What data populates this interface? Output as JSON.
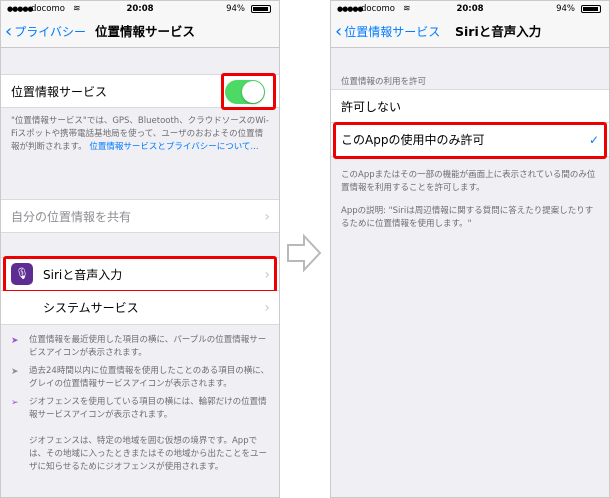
{
  "left": {
    "status": {
      "carrier": "docomo",
      "time": "20:08",
      "battery": "94%"
    },
    "nav": {
      "back_label": "プライバシー",
      "title": "位置情報サービス"
    },
    "location_toggle": {
      "label": "位置情報サービス",
      "on": true
    },
    "footer": {
      "text": "\"位置情報サービス\"では、GPS、Bluetooth、クラウドソースのWi-Fiスポットや携帯電話基地局を使って、ユーザのおおよその位置情報が判断されます。",
      "link": "位置情報サービスとプライバシーについて..."
    },
    "share_cell": {
      "label": "自分の位置情報を共有"
    },
    "siri_cell": {
      "label": "Siriと音声入力"
    },
    "system_cell": {
      "label": "システムサービス"
    },
    "legend": [
      {
        "icon": "purple-location-arrow-icon",
        "color": "#a052d1",
        "text": "位置情報を最近使用した項目の横に、パープルの位置情報サービスアイコンが表示されます。"
      },
      {
        "icon": "gray-location-arrow-icon",
        "color": "#8e8e93",
        "text": "過去24時間以内に位置情報を使用したことのある項目の横に、グレイの位置情報サービスアイコンが表示されます。"
      },
      {
        "icon": "outline-location-arrow-icon",
        "color": "#a052d1",
        "text": "ジオフェンスを使用している項目の横には、輪郭だけの位置情報サービスアイコンが表示されます。"
      }
    ],
    "geofence_note": "ジオフェンスは、特定の地域を囲む仮想の境界です。Appでは、その地域に入ったときまたはその地域から出たことをユーザに知らせるためにジオフェンスが使用されます。"
  },
  "right": {
    "status": {
      "carrier": "docomo",
      "time": "20:08",
      "battery": "94%"
    },
    "nav": {
      "back_label": "位置情報サービス",
      "title": "Siriと音声入力"
    },
    "section_header": "位置情報の利用を許可",
    "options": [
      {
        "label": "許可しない",
        "selected": false
      },
      {
        "label": "このAppの使用中のみ許可",
        "selected": true
      }
    ],
    "footer1": "このAppまたはその一部の機能が画面上に表示されている間のみ位置情報を利用することを許可します。",
    "footer2": "Appの説明: \"Siriは周辺情報に関する質問に答えたり提案したりするために位置情報を使用します。\""
  },
  "colors": {
    "accent": "#007aff",
    "toggle_on": "#4cd964",
    "highlight": "#ee0000",
    "siri_icon": "#5e2d91"
  }
}
